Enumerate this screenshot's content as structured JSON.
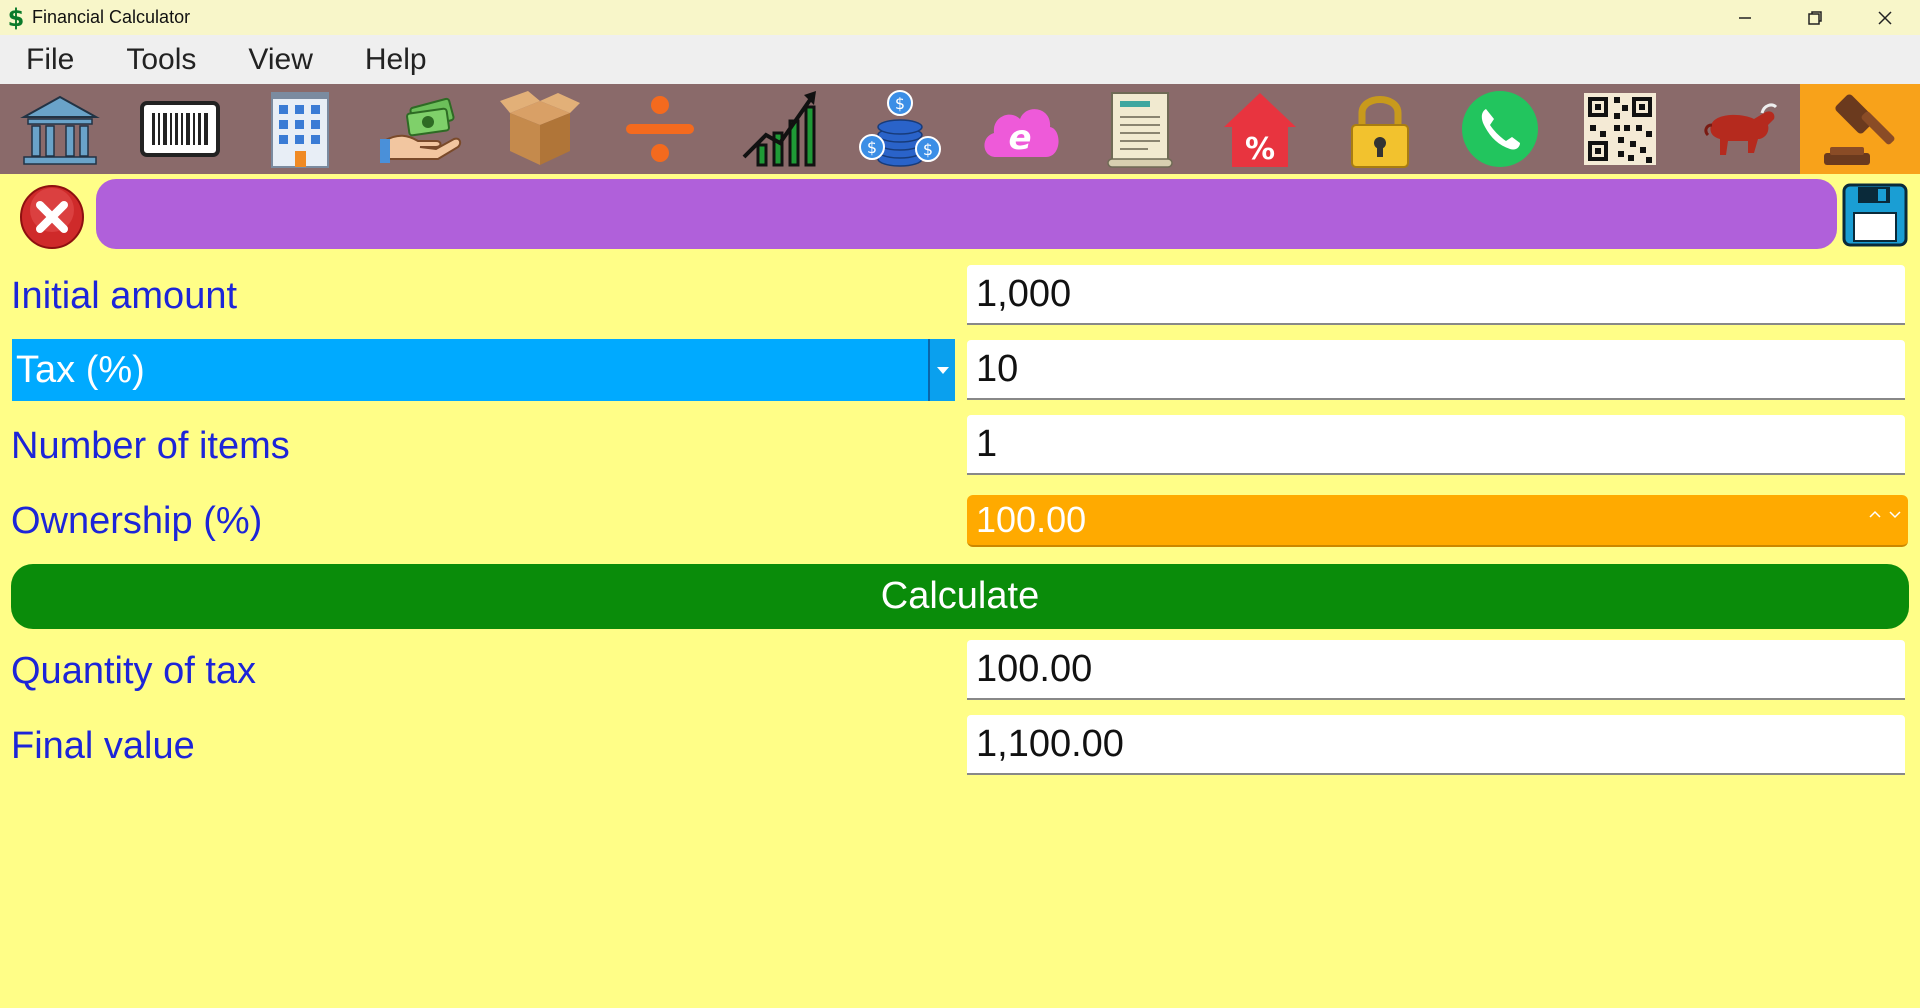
{
  "window": {
    "title": "Financial Calculator",
    "app_icon_glyph": "$",
    "controls": [
      "minimize-icon",
      "restore-icon",
      "close-icon"
    ]
  },
  "menu": {
    "items": [
      "File",
      "Tools",
      "View",
      "Help"
    ]
  },
  "toolbar": {
    "icons": [
      "bank-icon",
      "barcode-icon",
      "office-building-icon",
      "money-hand-icon",
      "box-icon",
      "division-icon",
      "growth-chart-icon",
      "coins-icon",
      "browser-cloud-icon",
      "receipt-icon",
      "home-percent-icon",
      "padlock-icon",
      "phone-icon",
      "qr-code-icon",
      "bull-icon",
      "gavel-icon"
    ],
    "active_index": 15
  },
  "form": {
    "initial_amount": {
      "label": "Initial amount",
      "value": "1,000"
    },
    "tax": {
      "selected": "Tax (%)",
      "value": "10"
    },
    "items": {
      "label": "Number of items",
      "value": "1"
    },
    "ownership": {
      "label": "Ownership (%)",
      "value": "100.00"
    },
    "calculate_label": "Calculate",
    "quantity_of_tax": {
      "label": "Quantity of tax",
      "value": "100.00"
    },
    "final_value": {
      "label": "Final value",
      "value": "1,100.00"
    }
  },
  "colors": {
    "background": "#fffe87",
    "toolbar": "#8a6a6a",
    "active_tool": "#f8a21a",
    "status_bar": "#b060da",
    "label_text": "#1d25d8",
    "tax_select": "#00aaff",
    "ownership_field": "#ffaa00",
    "calculate_button": "#0a8c0a"
  }
}
